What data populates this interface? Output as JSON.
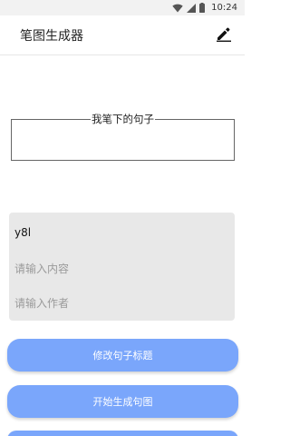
{
  "status_bar": {
    "time": "10:24",
    "icons": [
      "wifi-icon",
      "cellular-signal-icon",
      "battery-icon"
    ]
  },
  "app_bar": {
    "title": "笔图生成器",
    "action_icon": "edit-pencil-icon"
  },
  "sentence_box": {
    "legend": "我笔下的句子",
    "content": ""
  },
  "input_panel": {
    "title_value": "y8l",
    "content_placeholder": "请输入内容",
    "author_placeholder": "请输入作者"
  },
  "buttons": {
    "modify_title": "修改句子标题",
    "start_generate": "开始生成句图"
  },
  "colors": {
    "button_bg": "#7aa6fb",
    "panel_bg": "#e8e8e8",
    "status_bar_bg": "#f2f2f2"
  }
}
